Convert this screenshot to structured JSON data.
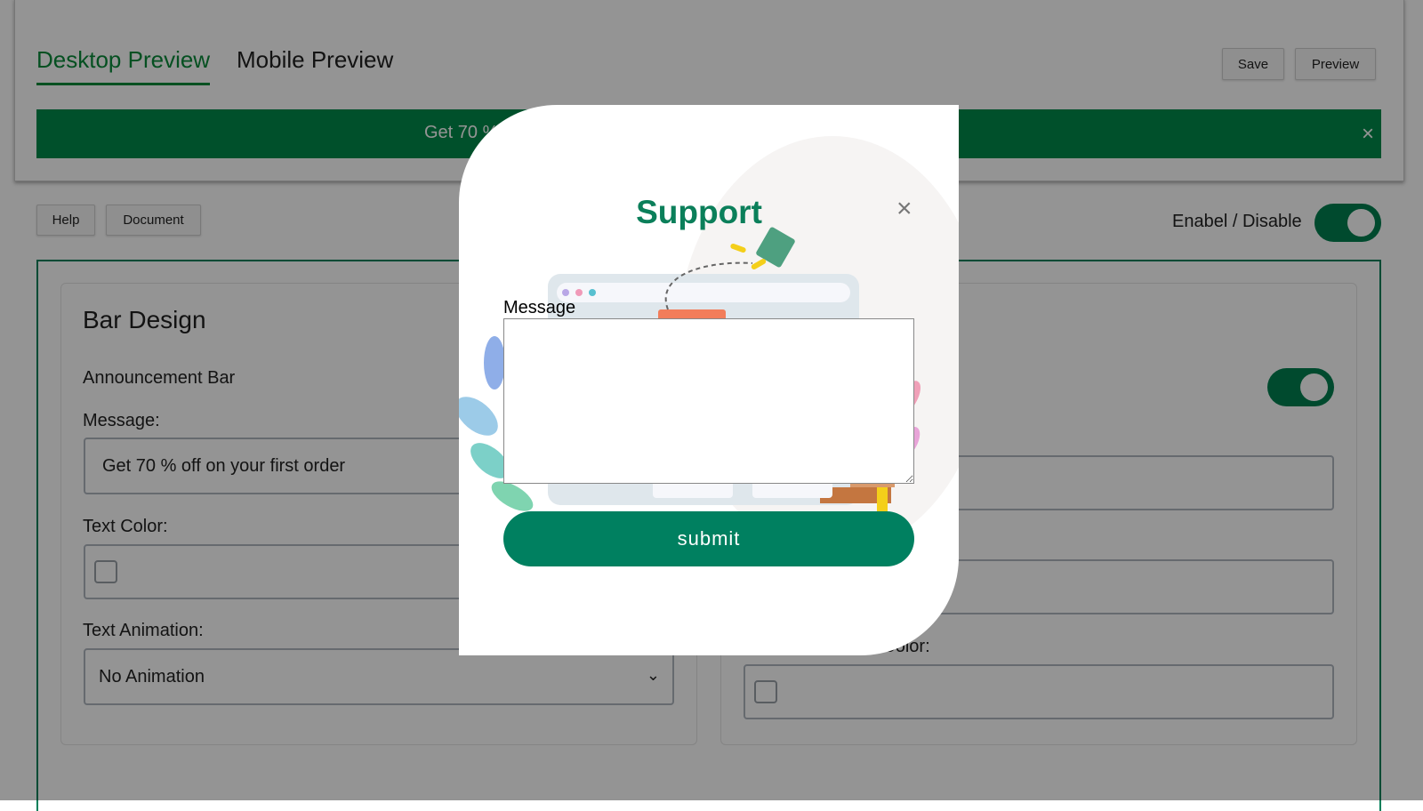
{
  "header": {
    "tabs": [
      {
        "label": "Desktop Preview",
        "active": true
      },
      {
        "label": "Mobile Preview",
        "active": false
      }
    ],
    "save_label": "Save",
    "preview_label": "Preview"
  },
  "announcement_preview": {
    "text": "Get 70 % off on your first order",
    "close": "×",
    "background": "#008a4a"
  },
  "toolbar": {
    "help_label": "Help",
    "document_label": "Document",
    "enable_label": "Enabel / Disable",
    "enabled": true
  },
  "bar_design": {
    "title": "Bar Design",
    "announcement_label": "Announcement Bar",
    "message_label": "Message:",
    "message_value": "Get 70 % off on your first order",
    "text_color_label": "Text Color:",
    "text_animation_label": "Text Animation:",
    "text_animation_value": "No Animation"
  },
  "right_card": {
    "toggle_on": true,
    "background_color_label": "Background Color:"
  },
  "modal": {
    "title": "Support",
    "close": "×",
    "message_label": "Message",
    "message_value": "",
    "submit_label": "submit",
    "accent": "#008060"
  }
}
